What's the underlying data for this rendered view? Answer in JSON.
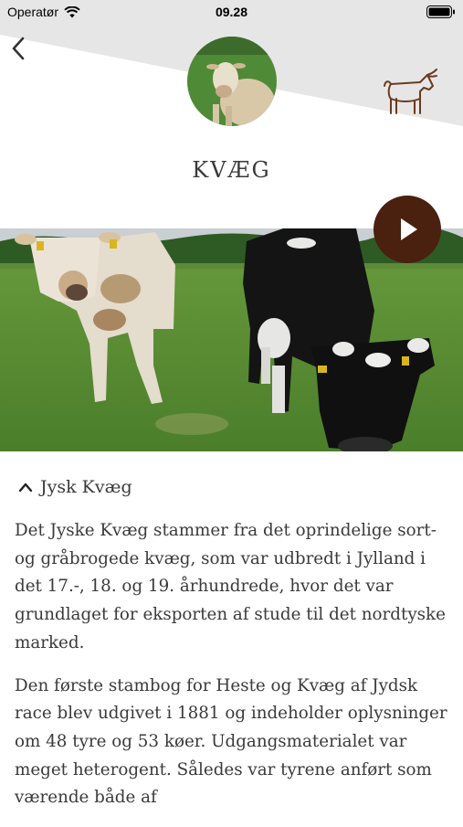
{
  "status_bar": {
    "carrier": "Operatør",
    "time": "09.28"
  },
  "header": {
    "back_icon": "chevron-left-icon",
    "animal_icon": "cow-outline-icon",
    "title": "KVÆG",
    "background_color": "#e6e6e6",
    "accent_color": "#4a200e"
  },
  "media": {
    "play_icon": "play-icon"
  },
  "section": {
    "toggle_icon": "chevron-up-icon",
    "title": "Jysk Kvæg",
    "paragraphs": [
      "Det Jyske Kvæg stammer fra det oprindelige sort- og gråbrogede kvæg, som var udbredt i Jylland i det 17.-, 18. og 19. århundrede, hvor det var grundlaget for eksporten af stude til det nordtyske marked.",
      "Den første stambog for Heste og Kvæg af Jydsk race blev udgivet i 1881 og indeholder oplysninger om 48 tyre og 53 køer. Udgangsmaterialet var meget heterogent. Således var tyrene anført som værende både af"
    ]
  }
}
